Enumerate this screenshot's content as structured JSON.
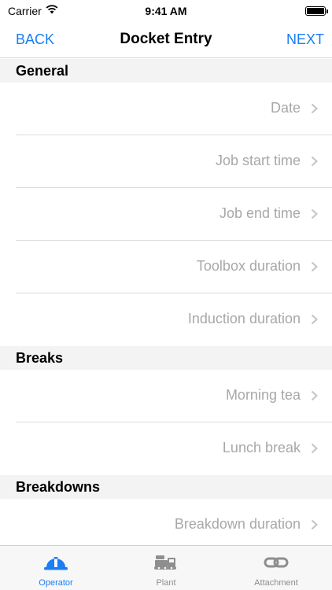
{
  "status_bar": {
    "carrier": "Carrier",
    "time": "9:41 AM"
  },
  "nav": {
    "back": "BACK",
    "title": "Docket Entry",
    "next": "NEXT"
  },
  "sections": [
    {
      "title": "General",
      "rows": [
        "Date",
        "Job start time",
        "Job end time",
        "Toolbox duration",
        "Induction duration"
      ]
    },
    {
      "title": "Breaks",
      "rows": [
        "Morning tea",
        "Lunch break"
      ]
    },
    {
      "title": "Breakdowns",
      "rows": [
        "Breakdown duration"
      ]
    }
  ],
  "tabs": [
    {
      "label": "Operator",
      "icon": "hard-hat-icon",
      "active": true
    },
    {
      "label": "Plant",
      "icon": "truck-icon",
      "active": false
    },
    {
      "label": "Attachment",
      "icon": "link-icon",
      "active": false
    }
  ],
  "colors": {
    "accent": "#1a7ef5",
    "row_label": "#a8a8a8",
    "tab_inactive": "#8e8e8e",
    "section_bg": "#f3f3f3"
  }
}
